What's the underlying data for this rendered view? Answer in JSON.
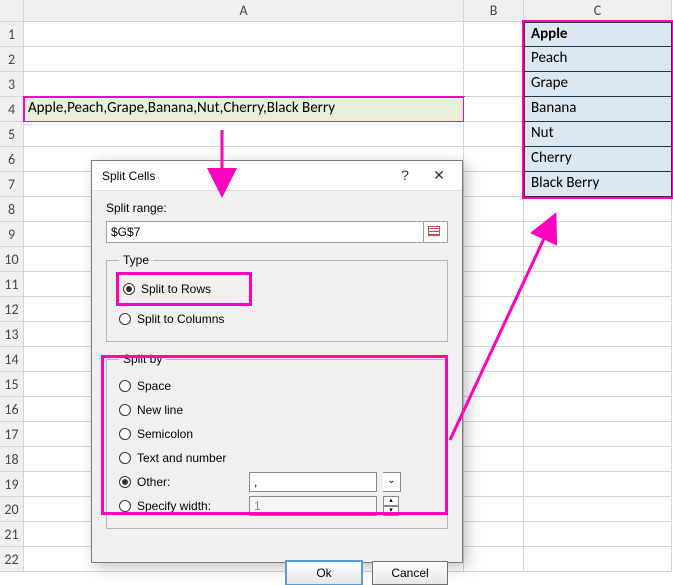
{
  "grid": {
    "cols": [
      "A",
      "B",
      "C"
    ],
    "rowCount": 22,
    "a4": "Apple,Peach,Grape,Banana,Nut,Cherry,Black Berry"
  },
  "results": [
    "Apple",
    "Peach",
    "Grape",
    "Banana",
    "Nut",
    "Cherry",
    "Black Berry"
  ],
  "dialog": {
    "title": "Split Cells",
    "help": "?",
    "close": "✕",
    "splitRangeLabel": "Split range:",
    "splitRangeValue": "$G$7",
    "typeLegend": "Type",
    "optRows": "Split to Rows",
    "optCols": "Split to Columns",
    "splitByLegend": "Split by",
    "optSpace": "Space",
    "optNewline": "New line",
    "optSemicolon": "Semicolon",
    "optTextNum": "Text and number",
    "optOther": "Other:",
    "otherValue": ",",
    "optSpecWidth": "Specify width:",
    "specWidthValue": "1",
    "ok": "Ok",
    "cancel": "Cancel"
  }
}
